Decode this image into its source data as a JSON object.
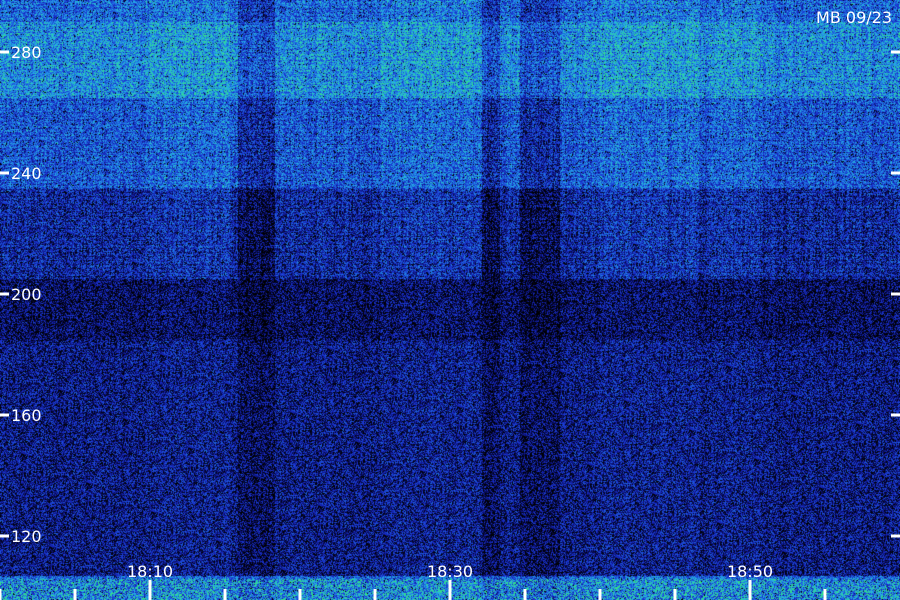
{
  "chart_data": {
    "type": "heatmap",
    "title": "",
    "watermark": "MB 09/23",
    "xlabel": "",
    "ylabel": "",
    "x_range_minutes": [
      -7,
      23
    ],
    "x_tick_labels": [
      {
        "label": "18:10",
        "minute": 0
      },
      {
        "label": "18:30",
        "minute": 10
      },
      {
        "label": "18:50",
        "minute": 20
      }
    ],
    "x_minor_ticks_minutes": [
      -5,
      -2.5,
      2.5,
      5,
      7.5,
      12.5,
      15,
      17.5,
      22.5
    ],
    "y_range": [
      107,
      305
    ],
    "y_tick_values": [
      120,
      160,
      200,
      240,
      280
    ],
    "y_tick_labels": [
      "120",
      "160",
      "200",
      "240",
      "280"
    ],
    "colormap": [
      "#000000",
      "#0a0f6a",
      "#1a2fcf",
      "#1f6fe0",
      "#25b0e8",
      "#33e08a"
    ],
    "intensity_bands": [
      {
        "y_from": 265,
        "y_to": 290,
        "level": 0.72
      },
      {
        "y_from": 235,
        "y_to": 265,
        "level": 0.55
      },
      {
        "y_from": 205,
        "y_to": 235,
        "level": 0.36
      },
      {
        "y_from": 185,
        "y_to": 205,
        "level": 0.2
      },
      {
        "y_from": 107,
        "y_to": 185,
        "level": 0.28
      }
    ]
  }
}
